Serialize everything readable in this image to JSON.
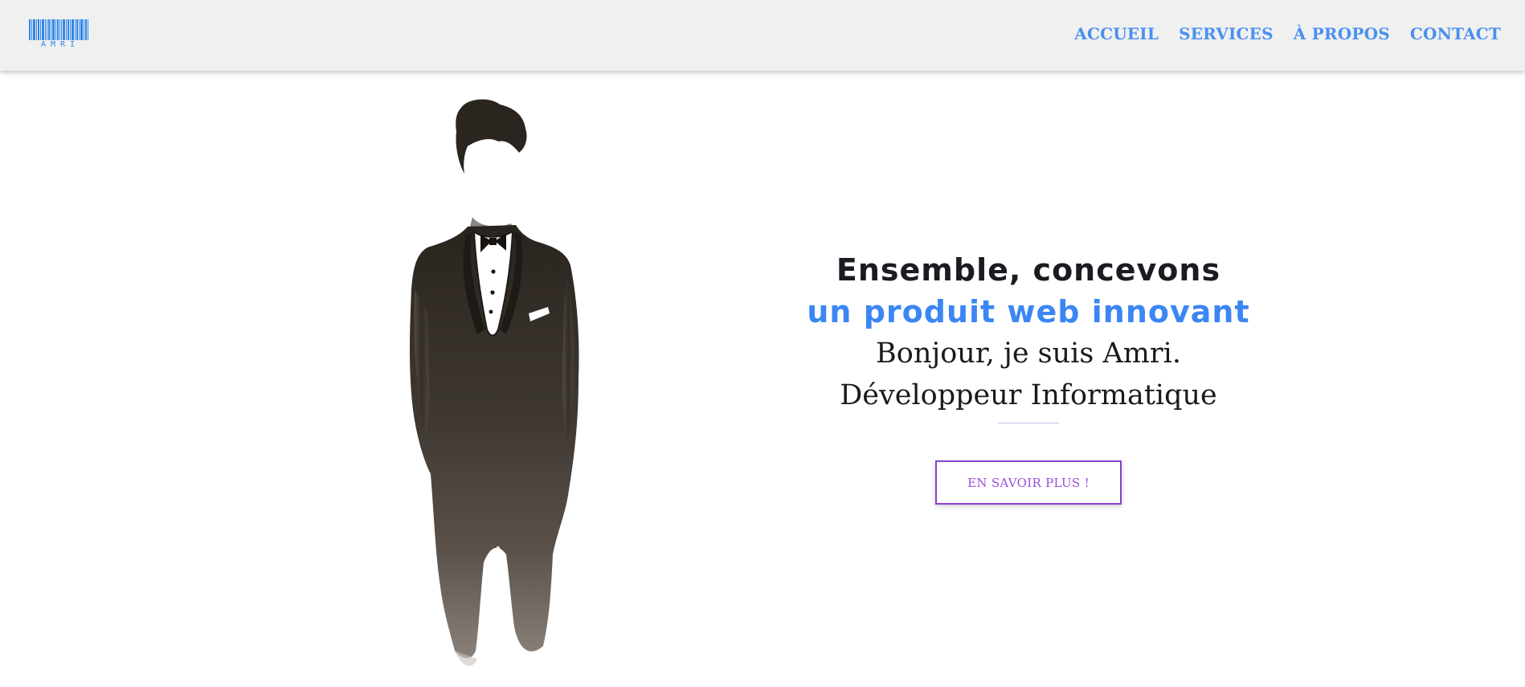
{
  "brand": {
    "logo_text": "AMRI",
    "color": "#2f86e8"
  },
  "nav": {
    "items": [
      {
        "label": "ACCUEIL"
      },
      {
        "label": "SERVICES"
      },
      {
        "label": "À PROPOS"
      },
      {
        "label": "CONTACT"
      }
    ],
    "color": "#4a90f0"
  },
  "hero": {
    "headline_line1": "Ensemble, concevons",
    "headline_line2": "un produit web innovant",
    "intro": "Bonjour, je suis Amri.",
    "role": "Développeur Informatique",
    "cta_label": "EN SAVOIR PLUS !",
    "accent": "#3b86f3",
    "cta_color": "#8a3fd1"
  },
  "illustration": {
    "icon": "watercolor-man-in-tuxedo"
  }
}
